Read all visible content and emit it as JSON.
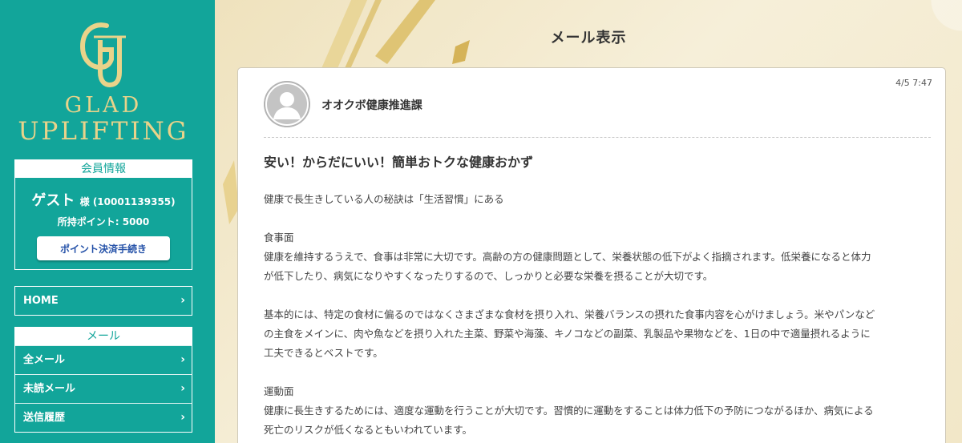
{
  "brand": {
    "line1": "GLAD",
    "line2": "UPLIFTING",
    "monogram": "GU",
    "gold": "#e9d38a"
  },
  "member": {
    "header": "会員情報",
    "name": "ゲスト",
    "suffix": "様 (10001139355)",
    "points": "所持ポイント: 5000",
    "pay_button": "ポイント決済手続き"
  },
  "nav": {
    "home": "HOME",
    "mail_header": "メール",
    "mail_items": [
      {
        "label": "全メール"
      },
      {
        "label": "未読メール"
      },
      {
        "label": "送信履歴"
      }
    ],
    "chevron": "›"
  },
  "page": {
    "title": "メール表示"
  },
  "mail": {
    "sender": "オオクボ健康推進課",
    "date": "4/5 7:47",
    "subject": "安い！からだにいい！簡単おトクな健康おかず",
    "body": [
      "健康で長生きしている人の秘訣は「生活習慣」にある",
      "",
      "食事面",
      "健康を維持するうえで、食事は非常に大切です。高齢の方の健康問題として、栄養状態の低下がよく指摘されます。低栄養になると体力",
      "が低下したり、病気になりやすくなったりするので、しっかりと必要な栄養を摂ることが大切です。",
      "",
      "基本的には、特定の食材に偏るのではなくさまざまな食材を摂り入れ、栄養バランスの摂れた食事内容を心がけましょう。米やパンなど",
      "の主食をメインに、肉や魚などを摂り入れた主菜、野菜や海藻、キノコなどの副菜、乳製品や果物などを、1日の中で適量摂れるように",
      "工夫できるとベストです。",
      "",
      "運動面",
      "健康に長生きするためには、適度な運動を行うことが大切です。習慣的に運動をすることは体力低下の予防につながるほか、病気による",
      "死亡のリスクが低くなるともいわれています。"
    ]
  },
  "colors": {
    "sidebar": "#12a59a",
    "accent_link": "#2451a8",
    "background": "#f4ecd2"
  }
}
